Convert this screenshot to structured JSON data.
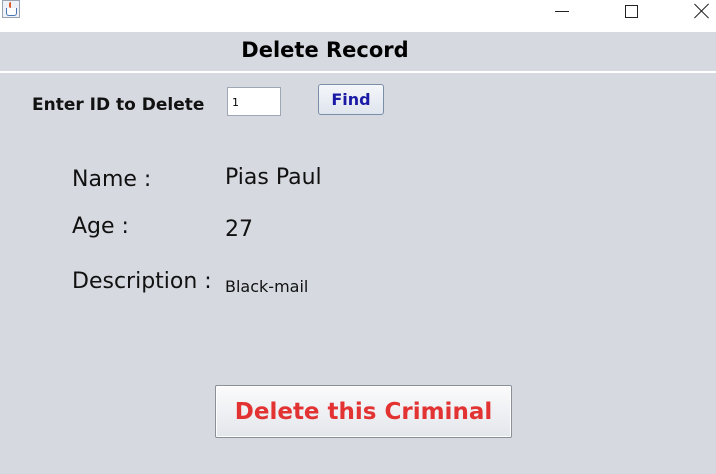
{
  "window": {
    "icon": "java-cup-icon",
    "controls": [
      "minimize-icon",
      "maximize-icon",
      "close-icon"
    ]
  },
  "header": {
    "title": "Delete Record"
  },
  "search": {
    "label": "Enter ID to Delete",
    "value": "1",
    "find_label": "Find"
  },
  "record": {
    "name_label": "Name :",
    "name_value": "Pias Paul",
    "age_label": "Age :",
    "age_value": "27",
    "description_label": "Description :",
    "description_value": "Black-mail"
  },
  "actions": {
    "delete_label": "Delete this Criminal"
  },
  "colors": {
    "background": "#d6d9e0",
    "find_text": "#1a1aa6",
    "delete_text": "#e23232"
  }
}
